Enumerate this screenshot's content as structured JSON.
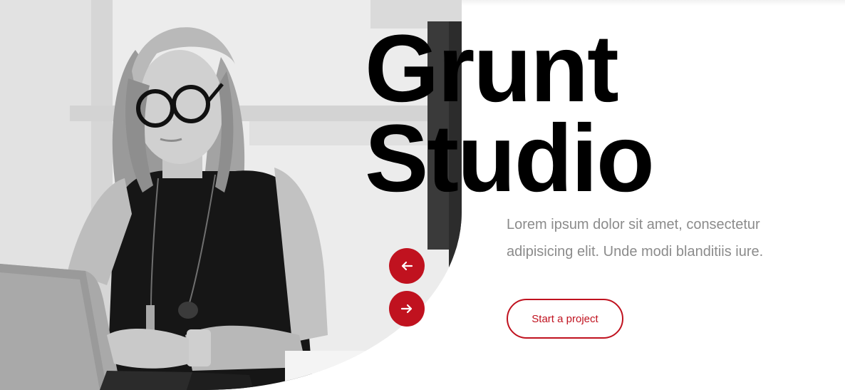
{
  "hero": {
    "title_line1": "Grunt",
    "title_line2": "Studio",
    "description": "Lorem ipsum dolor sit amet, consectetur adipisicing elit. Unde modi blanditiis iure.",
    "cta_label": "Start a project",
    "photo_icon": "photo-woman-laptop",
    "prev_icon": "arrow-left-icon",
    "next_icon": "arrow-right-icon"
  },
  "colors": {
    "accent": "#c0121f",
    "title": "#000000",
    "body_text": "#8b8b8b",
    "background": "#ffffff"
  }
}
